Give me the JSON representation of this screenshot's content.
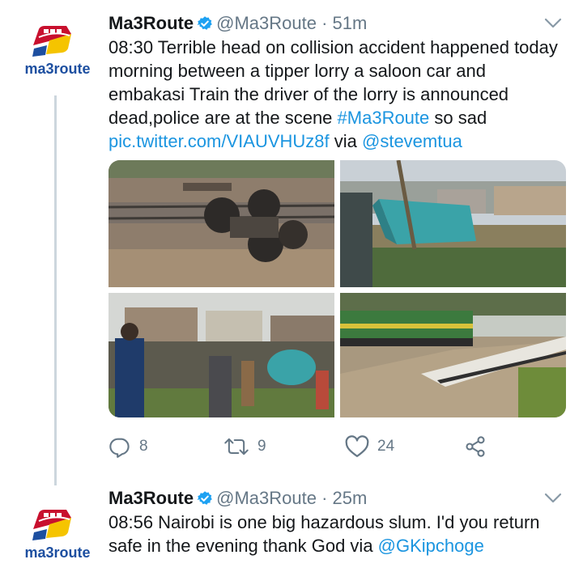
{
  "tweets": [
    {
      "name": "Ma3Route",
      "handle": "@Ma3Route",
      "dot": "·",
      "time": "51m",
      "avatar_text": "ma3route",
      "text_plain": "08:30 Terrible head on collision accident happened today morning between a tipper lorry a saloon car and embakasi Train the driver of the lorry is announced dead,police are at the scene ",
      "hashtag": "#Ma3Route",
      "text_after_hashtag": " so sad",
      "pic_link": "pic.twitter.com/VIAUVHUz8f",
      "via_text": " via ",
      "mention": "@stevemtua",
      "actions": {
        "replies": "8",
        "retweets": "9",
        "likes": "24"
      }
    },
    {
      "name": "Ma3Route",
      "handle": "@Ma3Route",
      "dot": "·",
      "time": "25m",
      "avatar_text": "ma3route",
      "text_plain": "08:56 Nairobi is one big hazardous slum. I'd you return safe in the evening thank God via ",
      "mention": "@GKipchoge"
    }
  ],
  "colors": {
    "link": "#1b95e0",
    "muted": "#657786",
    "verified": "#1da1f2",
    "brand_red": "#c8102e",
    "brand_yellow": "#f5c400",
    "brand_blue": "#1d4fa0"
  },
  "icons": [
    "verified-badge-icon",
    "chevron-down-icon",
    "reply-icon",
    "retweet-icon",
    "like-icon",
    "share-icon"
  ]
}
